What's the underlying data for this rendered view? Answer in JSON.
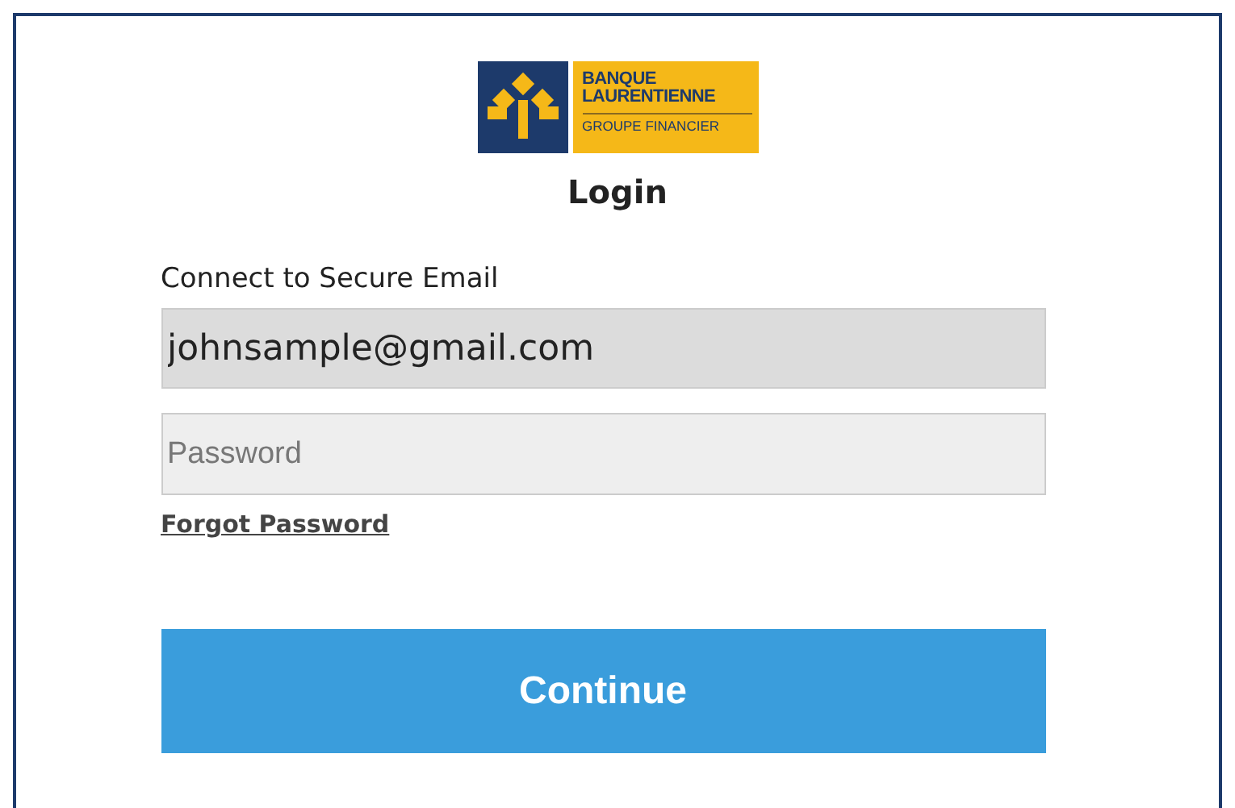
{
  "logo": {
    "line_1": "BANQUE",
    "line_2": "LAURENTIENNE",
    "line_3": "GROUPE FINANCIER"
  },
  "title": "Login",
  "subtitle": "Connect to Secure Email",
  "email": {
    "value": "johnsample@gmail.com"
  },
  "password": {
    "placeholder": "Password"
  },
  "forgot_link": "Forgot Password",
  "continue_button": "Continue"
}
